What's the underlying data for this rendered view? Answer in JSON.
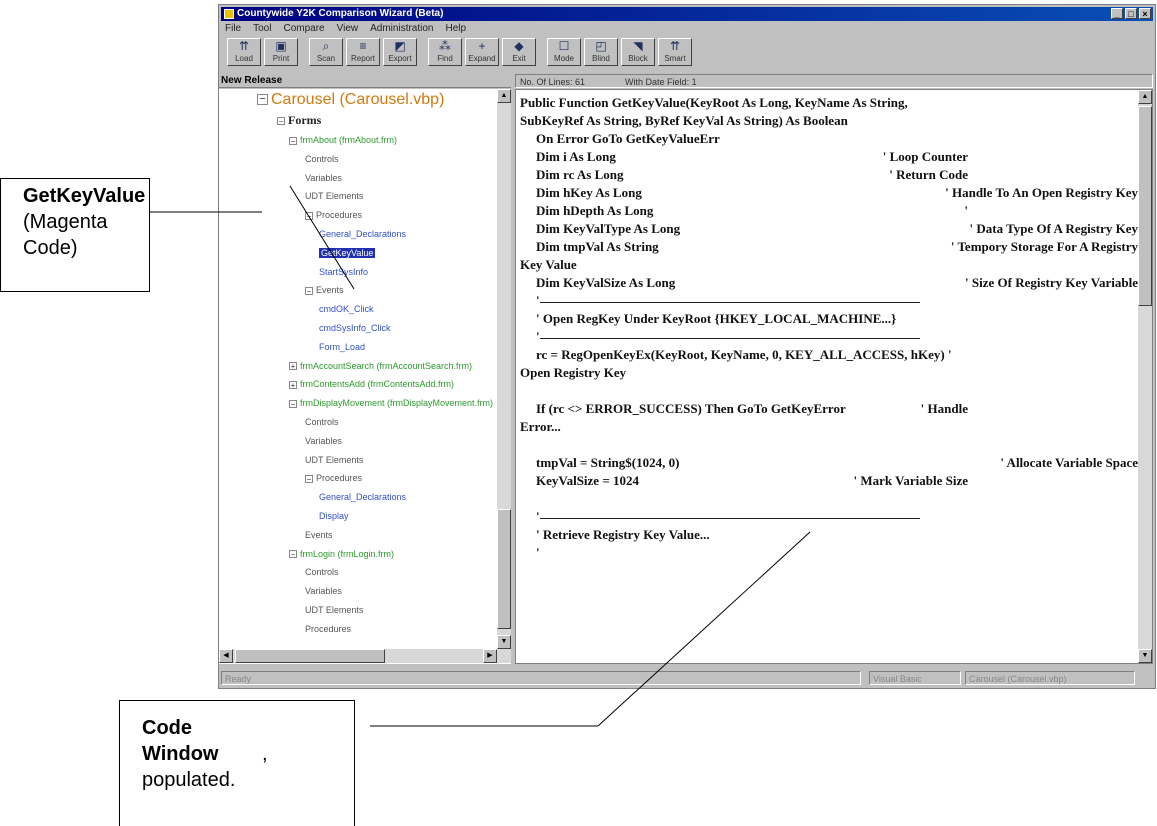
{
  "window": {
    "title": "Countywide Y2K Comparison Wizard (Beta)",
    "controls": [
      "_",
      "□",
      "×"
    ]
  },
  "menu": [
    "File",
    "Tool",
    "Compare",
    "View",
    "Administration",
    "Help"
  ],
  "toolbar": [
    {
      "label": "Load",
      "icon": "load-icon",
      "glyph": "⇈"
    },
    {
      "label": "Print",
      "icon": "print-icon",
      "glyph": "▣"
    },
    {
      "label": "Scan",
      "icon": "scan-icon",
      "glyph": "⌕"
    },
    {
      "label": "Report",
      "icon": "report-icon",
      "glyph": "≡"
    },
    {
      "label": "Export",
      "icon": "export-icon",
      "glyph": "◩"
    },
    {
      "label": "Find",
      "icon": "find-icon",
      "glyph": "⁂"
    },
    {
      "label": "Expand",
      "icon": "expand-icon",
      "glyph": "+"
    },
    {
      "label": "Exit",
      "icon": "exit-icon",
      "glyph": "◆"
    },
    {
      "label": "Mode",
      "icon": "mode-icon",
      "glyph": "☐"
    },
    {
      "label": "Blind",
      "icon": "blind-icon",
      "glyph": "◰"
    },
    {
      "label": "Block",
      "icon": "block-icon",
      "glyph": "◥"
    },
    {
      "label": "Smart",
      "icon": "smart-icon",
      "glyph": "⇈"
    }
  ],
  "left_pane_header": "New Release",
  "status_header": {
    "lines": "No. Of Lines: 61",
    "date": "With Date Field: 1"
  },
  "tree": {
    "root": "Carousel (Carousel.vbp)",
    "forms_label": "Forms",
    "nodes": [
      {
        "text": "frmAbout (frmAbout.frm)",
        "cls": "green",
        "box": "⊟"
      },
      {
        "text": "Controls",
        "cls": ""
      },
      {
        "text": "Variables",
        "cls": ""
      },
      {
        "text": "UDT Elements",
        "cls": ""
      },
      {
        "text": "Procedures",
        "cls": "",
        "box": "⊟"
      },
      {
        "text": "General_Declarations",
        "cls": "blue"
      },
      {
        "text": "GetKeyValue",
        "cls": "sel"
      },
      {
        "text": "StartSysInfo",
        "cls": "blue"
      },
      {
        "text": "Events",
        "cls": "",
        "box": "⊟"
      },
      {
        "text": "cmdOK_Click",
        "cls": "blue"
      },
      {
        "text": "cmdSysInfo_Click",
        "cls": "blue"
      },
      {
        "text": "Form_Load",
        "cls": "blue"
      },
      {
        "text": "frmAccountSearch (frmAccountSearch.frm)",
        "cls": "green",
        "box": "⊞"
      },
      {
        "text": "frmContentsAdd (frmContentsAdd.frm)",
        "cls": "green",
        "box": "⊞"
      },
      {
        "text": "frmDisplayMovement (frmDisplayMovement.frm)",
        "cls": "green",
        "box": "⊟"
      },
      {
        "text": "Controls",
        "cls": ""
      },
      {
        "text": "Variables",
        "cls": ""
      },
      {
        "text": "UDT Elements",
        "cls": ""
      },
      {
        "text": "Procedures",
        "cls": "",
        "box": "⊟"
      },
      {
        "text": "General_Declarations",
        "cls": "blue"
      },
      {
        "text": "Display",
        "cls": "blue"
      },
      {
        "text": "Events",
        "cls": ""
      },
      {
        "text": "frmLogin (frmLogin.frm)",
        "cls": "green",
        "box": "⊟"
      },
      {
        "text": "Controls",
        "cls": ""
      },
      {
        "text": "Variables",
        "cls": ""
      },
      {
        "text": "UDT Elements",
        "cls": ""
      },
      {
        "text": "Procedures",
        "cls": ""
      }
    ]
  },
  "code": [
    {
      "t": "Public Function GetKeyValue(KeyRoot As Long, KeyName As String,",
      "i": 0
    },
    {
      "t": "SubKeyRef As String, ByRef KeyVal As String) As Boolean",
      "i": 0
    },
    {
      "t": "On Error GoTo GetKeyValueErr",
      "i": 1
    },
    {
      "t": "Dim i As Long",
      "c": "' Loop Counter",
      "i": 1
    },
    {
      "t": "Dim rc As Long",
      "c": "' Return Code",
      "i": 1
    },
    {
      "t": "Dim hKey As Long",
      "c": "' Handle To An Open Registry Key",
      "i": 1
    },
    {
      "t": "Dim hDepth As Long",
      "c": "'",
      "i": 1
    },
    {
      "t": "Dim KeyValType As Long",
      "c": "' Data Type Of A Registry Key",
      "i": 1
    },
    {
      "t": "Dim tmpVal As String",
      "c": "' Tempory Storage For A Registry",
      "i": 1
    },
    {
      "t": "Key Value",
      "i": 0
    },
    {
      "t": "Dim KeyValSize As Long",
      "c": "' Size Of Registry Key Variable",
      "i": 1
    },
    {
      "t": "'",
      "i": 1,
      "rule": true
    },
    {
      "t": "' Open RegKey Under KeyRoot {HKEY_LOCAL_MACHINE...}",
      "i": 1
    },
    {
      "t": "'",
      "i": 1,
      "rule": true
    },
    {
      "t": "rc = RegOpenKeyEx(KeyRoot, KeyName, 0, KEY_ALL_ACCESS, hKey) '",
      "i": 1
    },
    {
      "t": "Open Registry Key",
      "i": 0
    },
    {
      "t": "",
      "i": 0
    },
    {
      "t": "If (rc <> ERROR_SUCCESS) Then GoTo GetKeyError",
      "c": "' Handle",
      "i": 1
    },
    {
      "t": "Error...",
      "i": 0
    },
    {
      "t": "",
      "i": 0
    },
    {
      "t": "tmpVal = String$(1024, 0)",
      "c": "' Allocate Variable Space",
      "i": 1
    },
    {
      "t": "KeyValSize = 1024",
      "c": "' Mark Variable Size",
      "i": 1
    },
    {
      "t": "",
      "i": 0
    },
    {
      "t": "'",
      "i": 1,
      "rule": true
    },
    {
      "t": "' Retrieve Registry Key Value...",
      "i": 1
    },
    {
      "t": "'",
      "i": 1
    }
  ],
  "statusbar": {
    "left": "Ready",
    "mid": "Visual Basic",
    "right": "Carousel (Carousel.vbp)"
  },
  "callouts": {
    "getkey": {
      "title": "GetKeyValue",
      "body": "(Magenta Code)"
    },
    "codewin": {
      "title": "Code Window",
      "body": ", populated."
    }
  }
}
